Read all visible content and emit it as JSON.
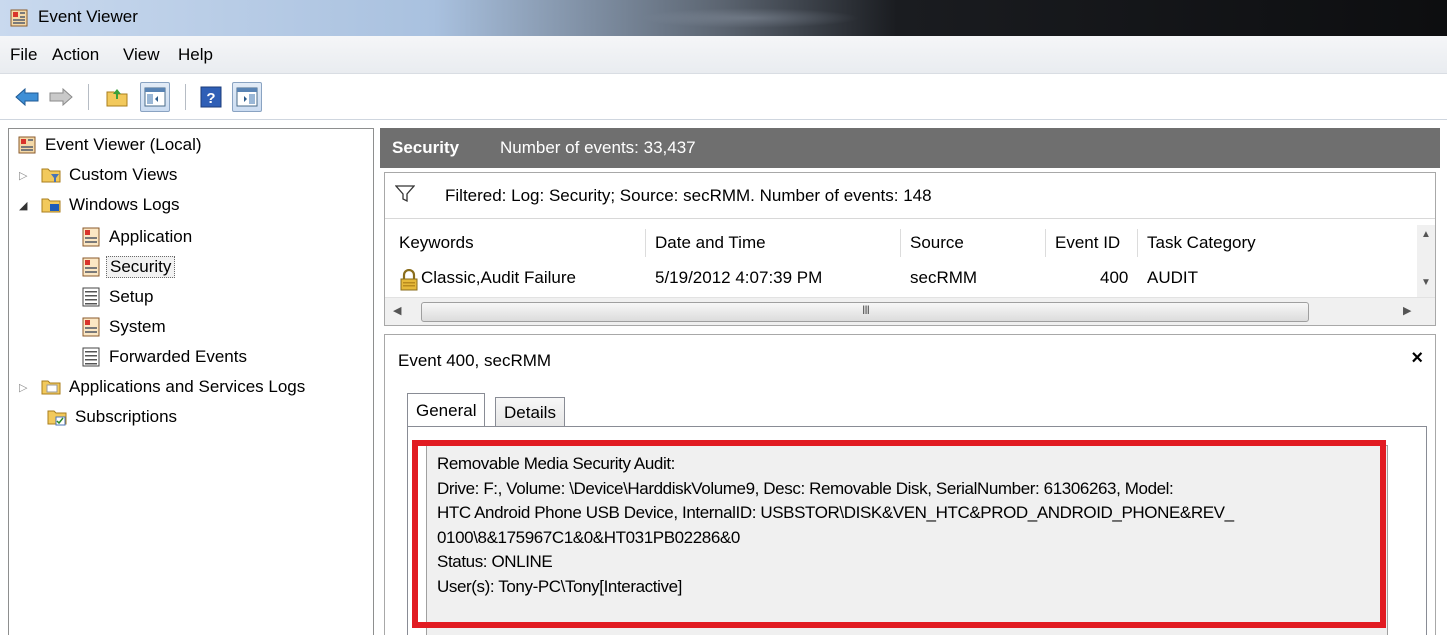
{
  "window": {
    "title": "Event Viewer",
    "icon": "event-viewer-icon"
  },
  "menu": {
    "items": [
      "File",
      "Action",
      "View",
      "Help"
    ]
  },
  "toolbar": {
    "buttons": [
      "back-arrow-icon",
      "forward-arrow-icon",
      "up-folder-icon",
      "show-hide-console-tree-icon",
      "help-icon",
      "show-hide-action-pane-icon"
    ]
  },
  "tree": {
    "root": "Event Viewer (Local)",
    "custom_views": "Custom Views",
    "windows_logs": "Windows Logs",
    "application": "Application",
    "security": "Security",
    "setup": "Setup",
    "system": "System",
    "forwarded_events": "Forwarded Events",
    "apps_services": "Applications and Services Logs",
    "subscriptions": "Subscriptions"
  },
  "header": {
    "log_name": "Security",
    "event_count": "Number of events: 33,437"
  },
  "filter": {
    "text": "Filtered: Log: Security; Source: secRMM. Number of events: 148"
  },
  "table": {
    "columns": [
      "Keywords",
      "Date and Time",
      "Source",
      "Event ID",
      "Task Category"
    ],
    "rows": [
      {
        "keywords": "Classic,Audit Failure",
        "date_time": "5/19/2012 4:07:39 PM",
        "source": "secRMM",
        "event_id": "400",
        "task_category": "AUDIT"
      }
    ]
  },
  "hscroll": {
    "grip": "III"
  },
  "detail": {
    "title": "Event 400, secRMM",
    "close_label": "×",
    "tabs": [
      "General",
      "Details"
    ],
    "message_lines": [
      "Removable Media Security Audit:",
      "Drive: F:, Volume: \\Device\\HarddiskVolume9, Desc: Removable Disk, SerialNumber: 61306263, Model:",
      "HTC Android Phone USB Device, InternalID: USBSTOR\\DISK&VEN_HTC&PROD_ANDROID_PHONE&REV_",
      "0100\\8&175967C1&0&HT031PB02286&0",
      "Status: ONLINE",
      "User(s): Tony-PC\\Tony[Interactive]"
    ]
  },
  "colors": {
    "highlight_box": "#e11b22",
    "header_bg": "#6f6f6f"
  }
}
